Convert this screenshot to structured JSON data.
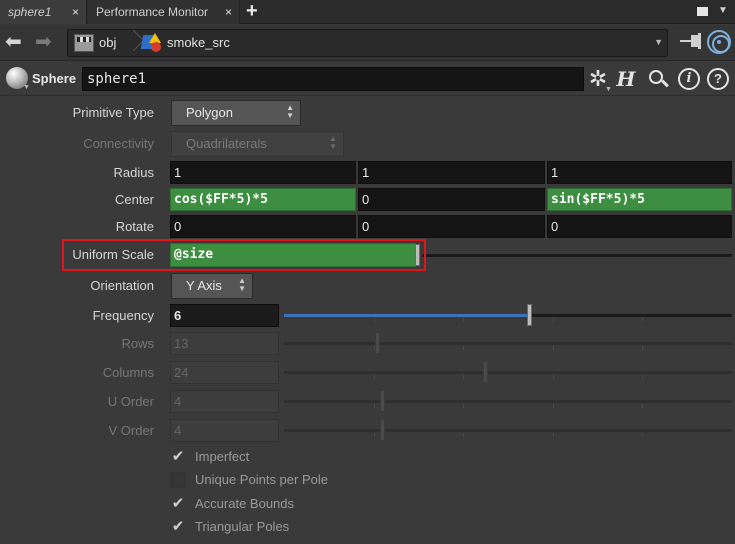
{
  "tabs": [
    {
      "label": "sphere1",
      "close": "×"
    },
    {
      "label": "Performance Monitor",
      "close": "×"
    }
  ],
  "tab_add": "+",
  "path": {
    "segments": [
      "obj",
      "smoke_src"
    ]
  },
  "node": {
    "type": "Sphere",
    "name": "sphere1"
  },
  "params": {
    "primitive_type": {
      "label": "Primitive Type",
      "value": "Polygon"
    },
    "connectivity": {
      "label": "Connectivity",
      "value": "Quadrilaterals"
    },
    "radius": {
      "label": "Radius",
      "values": [
        "1",
        "1",
        "1"
      ]
    },
    "center": {
      "label": "Center",
      "values": [
        "cos($FF*5)*5",
        "0",
        "sin($FF*5)*5"
      ]
    },
    "rotate": {
      "label": "Rotate",
      "values": [
        "0",
        "0",
        "0"
      ]
    },
    "uniform_scale": {
      "label": "Uniform Scale",
      "value": "@size"
    },
    "orientation": {
      "label": "Orientation",
      "value": "Y Axis"
    },
    "frequency": {
      "label": "Frequency",
      "value": "6",
      "slider_fraction": 0.55
    },
    "rows": {
      "label": "Rows",
      "value": "13",
      "slider_fraction": 0.21
    },
    "columns": {
      "label": "Columns",
      "value": "24",
      "slider_fraction": 0.45
    },
    "u_order": {
      "label": "U Order",
      "value": "4",
      "slider_fraction": 0.22
    },
    "v_order": {
      "label": "V Order",
      "value": "4",
      "slider_fraction": 0.22
    }
  },
  "toggles": [
    {
      "label": "Imperfect",
      "checked": true
    },
    {
      "label": "Unique Points per Pole",
      "checked": false
    },
    {
      "label": "Accurate Bounds",
      "checked": true
    },
    {
      "label": "Triangular Poles",
      "checked": true
    }
  ],
  "colors": {
    "expression_green": "#3e8e41",
    "highlight_red": "#e0141a",
    "slider_blue": "#3c73b8"
  }
}
